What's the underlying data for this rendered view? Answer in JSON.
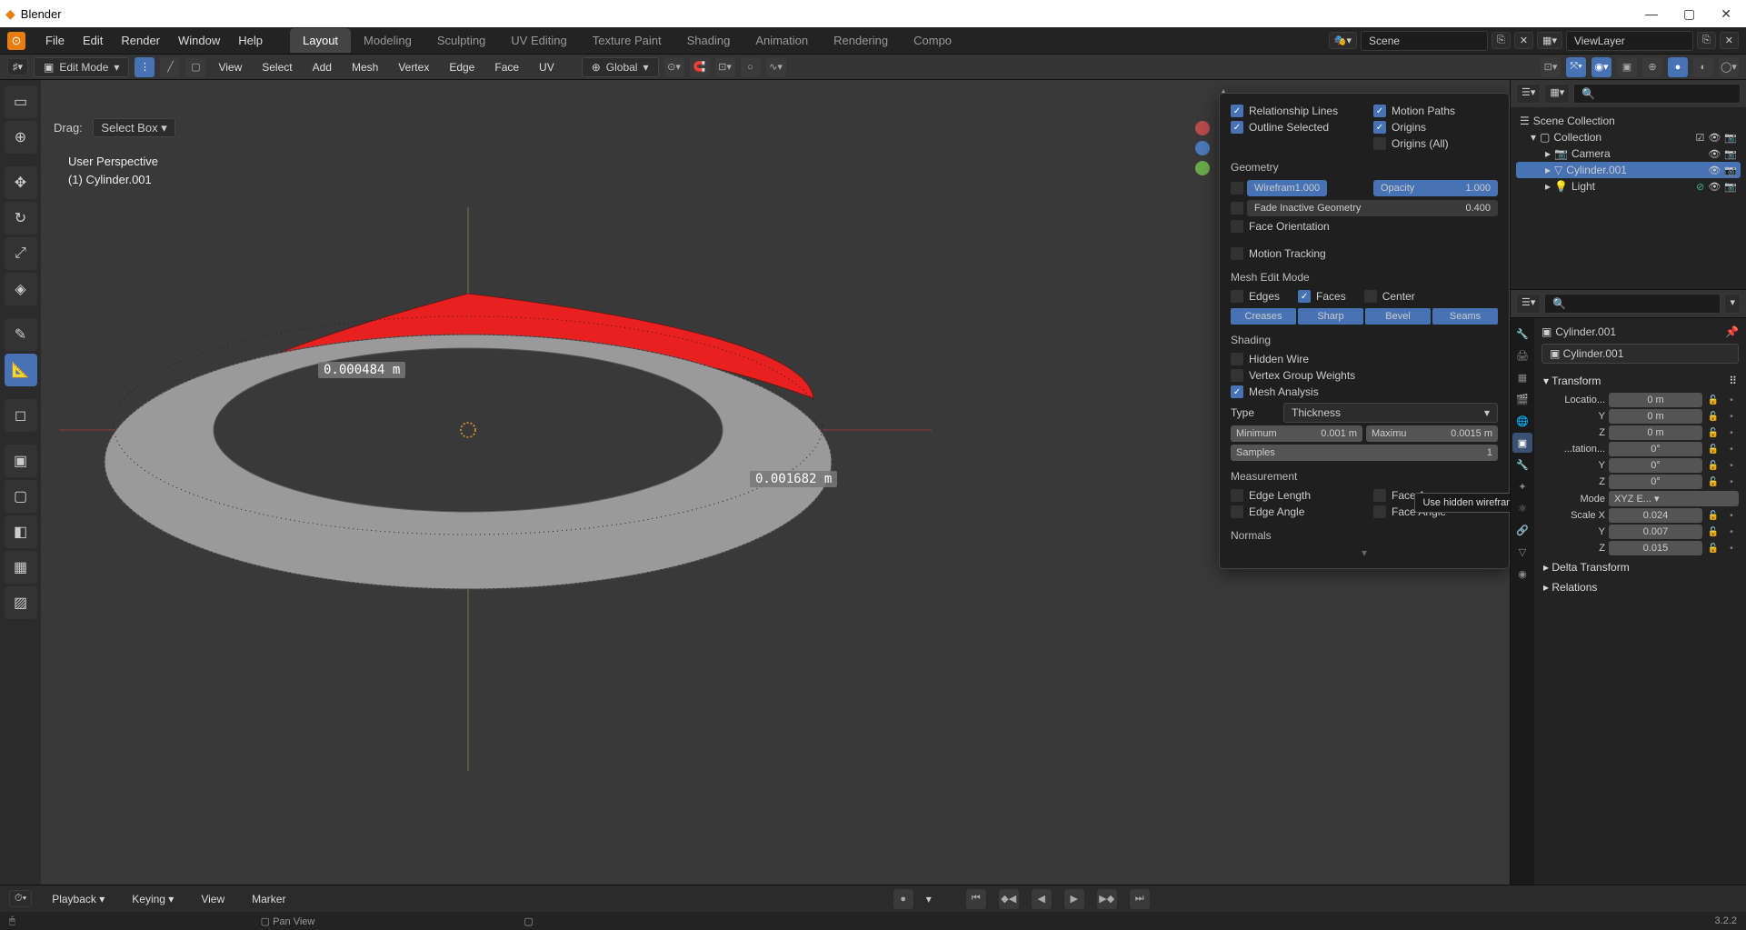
{
  "app": {
    "title": "Blender",
    "version": "3.2.2"
  },
  "menus": [
    "File",
    "Edit",
    "Render",
    "Window",
    "Help"
  ],
  "tabs": [
    "Layout",
    "Modeling",
    "Sculpting",
    "UV Editing",
    "Texture Paint",
    "Shading",
    "Animation",
    "Rendering",
    "Compo"
  ],
  "active_tab": "Layout",
  "scene": {
    "name": "Scene",
    "layer": "ViewLayer"
  },
  "mode": "Edit Mode",
  "hdr_menus": [
    "View",
    "Select",
    "Add",
    "Mesh",
    "Vertex",
    "Edge",
    "Face",
    "UV"
  ],
  "orientation": "Global",
  "drag_label": "Drag:",
  "drag_mode": "Select Box",
  "vp": {
    "perspective": "User Perspective",
    "object": "(1) Cylinder.001",
    "meas1": "0.000484 m",
    "meas2": "0.001682 m"
  },
  "popover": {
    "top": [
      {
        "label": "Relationship Lines",
        "on": true
      },
      {
        "label": "Outline Selected",
        "on": true
      },
      {
        "label": "Motion Paths",
        "on": true
      },
      {
        "label": "Origins",
        "on": true
      },
      {
        "label": "Origins (All)",
        "on": false
      }
    ],
    "sections": {
      "geometry": {
        "title": "Geometry",
        "wireframe": {
          "label": "Wirefram",
          "val": "1.000"
        },
        "opacity": {
          "label": "Opacity",
          "val": "1.000"
        },
        "fade": {
          "label": "Fade Inactive Geometry",
          "val": "0.400"
        },
        "faceori": {
          "label": "Face Orientation",
          "on": false
        }
      },
      "motion": {
        "label": "Motion Tracking",
        "on": false
      },
      "meshedit": {
        "title": "Mesh Edit Mode",
        "edges": {
          "label": "Edges",
          "on": false
        },
        "faces": {
          "label": "Faces",
          "on": true
        },
        "center": {
          "label": "Center",
          "on": false
        },
        "btns": [
          "Creases",
          "Sharp",
          "Bevel",
          "Seams"
        ]
      },
      "shading": {
        "title": "Shading",
        "hidden": {
          "label": "Hidden Wire",
          "on": false
        },
        "vgw": {
          "label": "Vertex Group Weights",
          "on": false
        },
        "mesh": {
          "label": "Mesh Analysis",
          "on": true
        },
        "type_lbl": "Type",
        "type_val": "Thickness",
        "min_lbl": "Minimum",
        "min_val": "0.001 m",
        "max_lbl": "Maximu",
        "max_val": "0.0015 m",
        "samples_lbl": "Samples",
        "samples_val": "1"
      },
      "measurement": {
        "title": "Measurement",
        "items": [
          {
            "label": "Edge Length",
            "on": false
          },
          {
            "label": "Edge Angle",
            "on": false
          },
          {
            "label": "Face Area",
            "on": false
          },
          {
            "label": "Face Angle",
            "on": false
          }
        ]
      },
      "normals": {
        "title": "Normals"
      }
    },
    "tooltip": "Use hidden wireframe display."
  },
  "outliner": {
    "root": "Scene Collection",
    "coll": "Collection",
    "items": [
      "Camera",
      "Cylinder.001",
      "Light"
    ],
    "selected": "Cylinder.001"
  },
  "props": {
    "obj": "Cylinder.001",
    "data": "Cylinder.001",
    "transform": {
      "title": "Transform",
      "loc_lbl": "Locatio...",
      "loc": [
        "0 m",
        "0 m",
        "0 m"
      ],
      "rot_lbl": "...tation...",
      "rot": [
        "0°",
        "0°",
        "0°"
      ],
      "mode_lbl": "Mode",
      "mode_val": "XYZ E...",
      "scale_lbl": "Scale X",
      "scale": [
        "0.024",
        "0.007",
        "0.015"
      ],
      "axes": [
        "Y",
        "Z"
      ]
    },
    "delta": "Delta Transform",
    "rel": "Relations"
  },
  "timeline": {
    "items": [
      "Playback",
      "Keying",
      "View",
      "Marker"
    ]
  },
  "status": {
    "hint": "Pan View"
  }
}
